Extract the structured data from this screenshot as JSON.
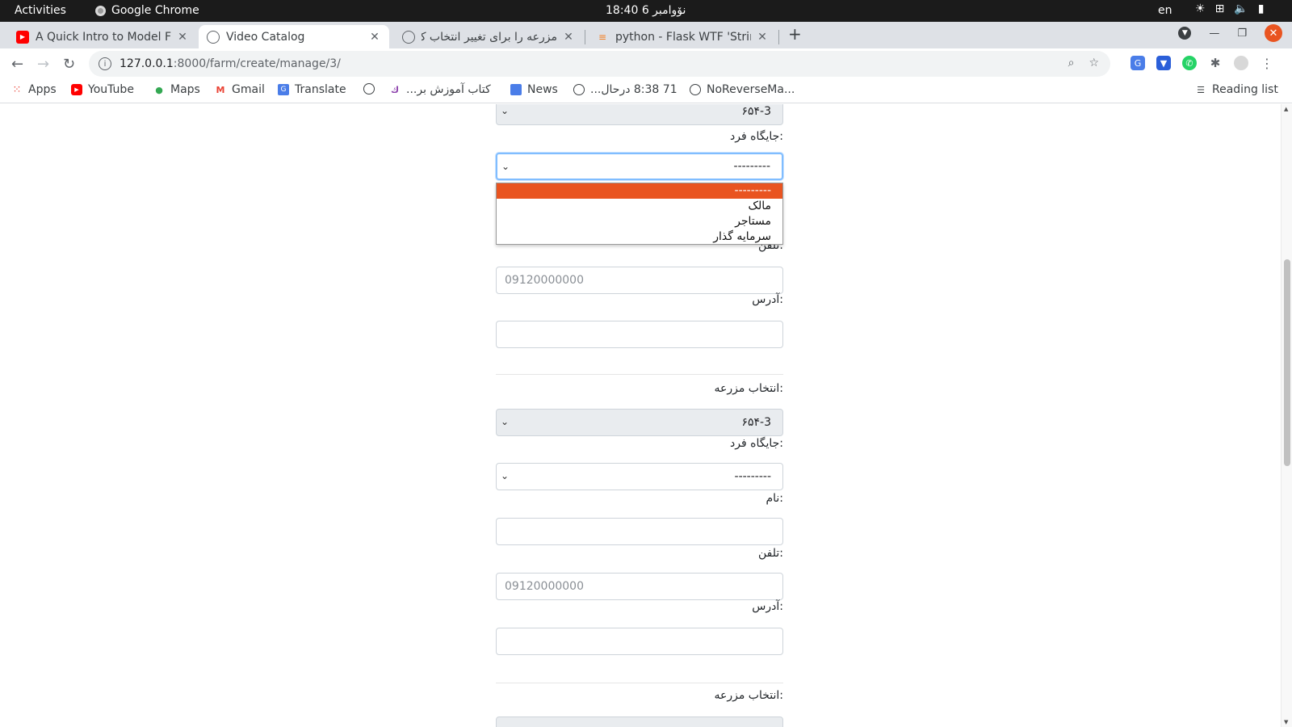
{
  "system_bar": {
    "activities": "Activities",
    "app_name": "Google Chrome",
    "clock": "نۆوامبر 6  18:40",
    "lang": "en"
  },
  "tabs": [
    {
      "title": "A Quick Intro to Model Fo",
      "icon": "youtube-icon"
    },
    {
      "title": "Video Catalog",
      "icon": "globe-icon"
    },
    {
      "title": "مزرعه را برای تغییر انتخاب ک",
      "icon": "globe-icon"
    },
    {
      "title": "python - Flask WTF 'String",
      "icon": "stackoverflow-icon"
    }
  ],
  "toolbar": {
    "url_host": "127.0.0.1",
    "url_path": ":8000/farm/create/manage/3/"
  },
  "bookmarks": [
    {
      "label": "Apps",
      "icon": "apps-grid-icon"
    },
    {
      "label": "YouTube",
      "icon": "youtube-icon"
    },
    {
      "label": "Maps",
      "icon": "maps-icon"
    },
    {
      "label": "Gmail",
      "icon": "gmail-icon"
    },
    {
      "label": "Translate",
      "icon": "translate-icon"
    },
    {
      "label": "",
      "icon": "globe-icon"
    },
    {
      "label": "کتاب آموزش بر...",
      "icon": "book-icon"
    },
    {
      "label": "News",
      "icon": "news-icon"
    },
    {
      "label": "71 8:38 درحال...",
      "icon": "globe-icon"
    },
    {
      "label": "NoReverseMa...",
      "icon": "globe-icon"
    }
  ],
  "reading_list": "Reading list",
  "form": {
    "farm_label": ":انتخاب مزرعه",
    "farm_value": "۶۵۴-3",
    "role_label": ":جایگاه فرد",
    "role_value": "---------",
    "name_label": ":نام",
    "phone_label": ":تلفن",
    "phone_placeholder": "09120000000",
    "address_label": ":آدرس"
  },
  "role_options": [
    "---------",
    "مالک",
    "مستاجر",
    "سرمایه گذار"
  ],
  "colors": {
    "accent": "#e95420",
    "focus": "#80bdff"
  }
}
